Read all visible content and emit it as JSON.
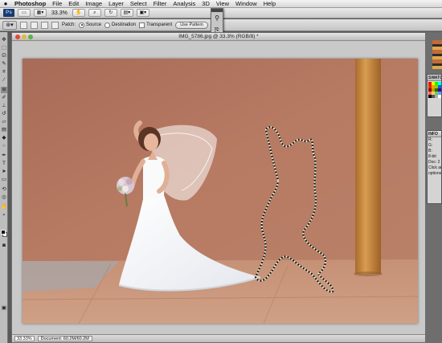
{
  "menubar": {
    "apple": "",
    "items": [
      "Photoshop",
      "File",
      "Edit",
      "Image",
      "Layer",
      "Select",
      "Filter",
      "Analysis",
      "3D",
      "View",
      "Window",
      "Help"
    ]
  },
  "appbar": {
    "logo": "Ps",
    "zoom": "33.3%"
  },
  "options": {
    "patch_label": "Patch:",
    "source_label": "Source",
    "destination_label": "Destination",
    "transparent_label": "Transparent",
    "use_pattern_label": "Use Pattern"
  },
  "document": {
    "title": "IMG_5786.jpg @ 33.3% (RGB/8) *",
    "zoom": "33.33%",
    "status": "Document: 60.2M/60.2M"
  },
  "panels": {
    "swatches_title": "SWATCHES",
    "info_title": "INFO",
    "info_r": "R:",
    "info_g": "G:",
    "info_b": "B:",
    "info_bit": "8-bit",
    "info_doc": "Doc: 2",
    "info_hint1": "Click an",
    "info_hint2": "options"
  },
  "colors": {
    "wall": "#b77a63",
    "floor": "#c7957a",
    "pillar": "#c98d45",
    "selection": "#e8d7b8"
  }
}
